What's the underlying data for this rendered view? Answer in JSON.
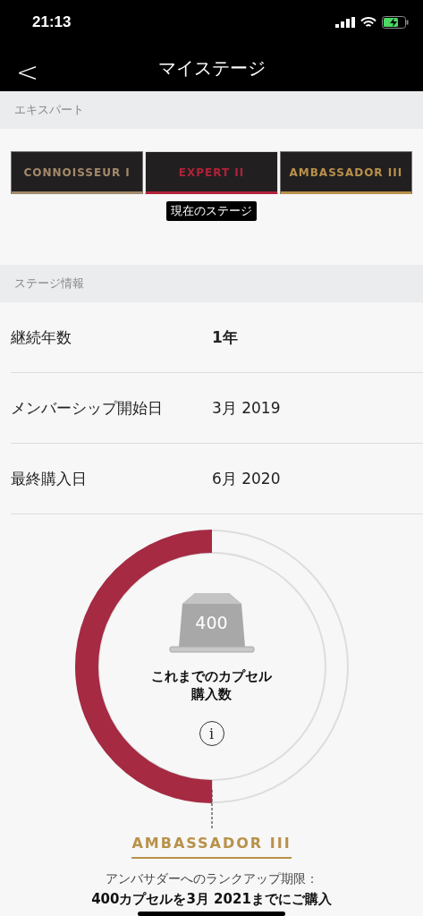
{
  "status_bar": {
    "time": "21:13"
  },
  "nav": {
    "title": "マイステージ",
    "back": "<"
  },
  "stage_section": {
    "header": "エキスパート",
    "tooltip": "現在のステージ",
    "stages": [
      {
        "label": "CONNOISSEUR I",
        "color": "#a38a6a",
        "selected": false
      },
      {
        "label": "EXPERT II",
        "color": "#b0223a",
        "selected": true
      },
      {
        "label": "AMBASSADOR III",
        "color": "#b8914a",
        "selected": false
      }
    ]
  },
  "info_section": {
    "header": "ステージ情報",
    "rows": [
      {
        "label": "継続年数",
        "value": "1年",
        "kind": "bold"
      },
      {
        "label": "メンバーシップ開始日",
        "value": "3月 2019",
        "kind": "plain"
      },
      {
        "label": "最終購入日",
        "value": "6月 2020",
        "kind": "plain"
      }
    ]
  },
  "progress": {
    "count": "400",
    "caption": "これまでのカプセル購入数",
    "info": "i",
    "target": "AMBASSADOR III",
    "note": "アンバサダーへのランクアップ期限：",
    "goal": "400カプセルを3月 2021までにご購入"
  }
}
